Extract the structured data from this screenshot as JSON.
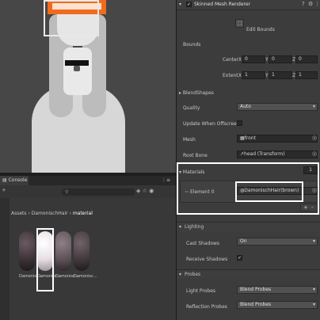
{
  "component": {
    "title": "Skinned Mesh Renderer",
    "edit_bounds": "Edit Bounds"
  },
  "bounds": {
    "label": "Bounds",
    "center_label": "Center",
    "extent_label": "Extent",
    "center": {
      "x": "0",
      "y": "0",
      "z": "0"
    },
    "extent": {
      "x": "1",
      "y": "1",
      "z": "1"
    },
    "x_label": "X",
    "y_label": "Y",
    "z_label": "Z"
  },
  "blendshapes_label": "BlendShapes",
  "quality": {
    "label": "Quality",
    "value": "Auto"
  },
  "update_offscreen": {
    "label": "Update When Offscreen"
  },
  "mesh": {
    "label": "Mesh",
    "value": "front"
  },
  "root_bone": {
    "label": "Root Bone",
    "value": "↗head (Transform)"
  },
  "materials": {
    "label": "Materials",
    "count": "1",
    "element_label": "Element 0",
    "element_value": "DamonischHair(brown)",
    "plus": "+",
    "minus": "-"
  },
  "lighting": {
    "label": "Lighting",
    "cast_shadows_label": "Cast Shadows",
    "cast_shadows_value": "On",
    "receive_shadows_label": "Receive Shadows"
  },
  "probes": {
    "label": "Probes",
    "light_probes_label": "Light Probes",
    "light_probes_value": "Blend Probes",
    "reflection_probes_label": "Reflection Probes",
    "reflection_probes_value": "Blend Probes"
  },
  "console": {
    "tab": "Console"
  },
  "project": {
    "breadcrumb": [
      "Assets",
      "DamonischHair",
      "material"
    ],
    "items": [
      {
        "label": "Damonisc...",
        "color": "#3a3035"
      },
      {
        "label": "Damonisc...",
        "color": "#e8dfe4"
      },
      {
        "label": "Damonisc...",
        "color": "#5a4e55"
      },
      {
        "label": "Damonisc...",
        "color": "#40373b"
      }
    ]
  }
}
